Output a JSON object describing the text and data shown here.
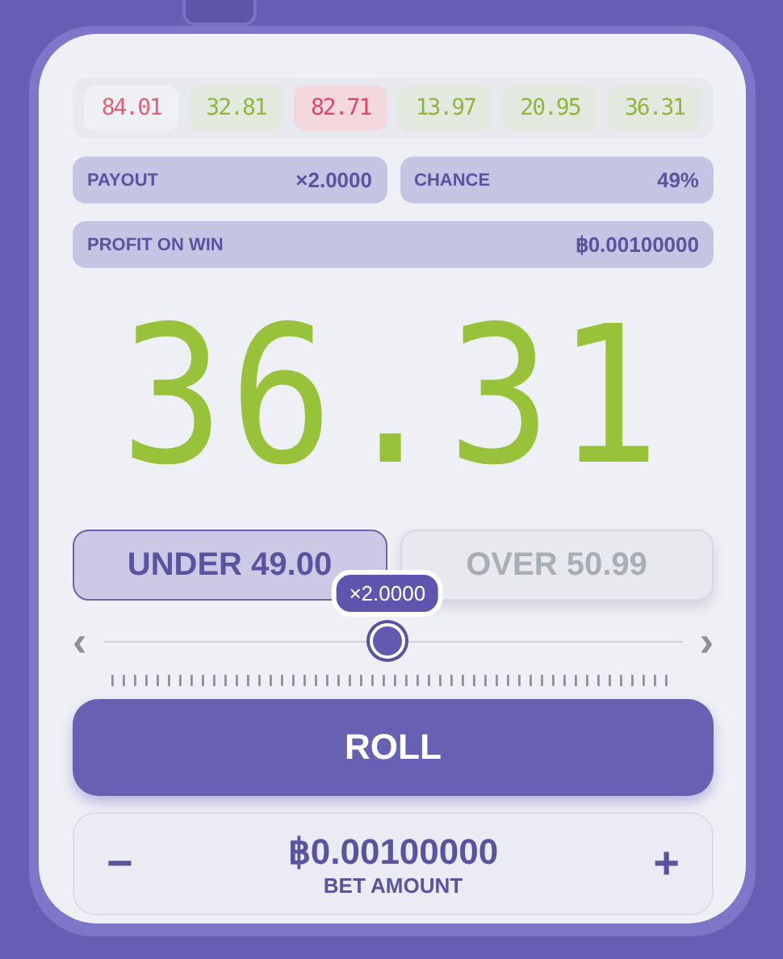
{
  "history": [
    {
      "value": "84.01",
      "color": "#e0607a",
      "faded": true
    },
    {
      "value": "32.81",
      "color": "#8fb83a",
      "faded": false
    },
    {
      "value": "82.71",
      "color": "#e0456a",
      "faded": false
    },
    {
      "value": "13.97",
      "color": "#8fb83a",
      "faded": false
    },
    {
      "value": "20.95",
      "color": "#8fb83a",
      "faded": false
    },
    {
      "value": "36.31",
      "color": "#8fb83a",
      "faded": false
    }
  ],
  "stats": [
    {
      "label": "PAYOUT",
      "value": "×2.0000"
    },
    {
      "label": "CHANCE",
      "value": "49%"
    }
  ],
  "profit": {
    "label": "PROFIT ON WIN",
    "value": "฿0.00100000"
  },
  "result": "36.31",
  "modes": [
    {
      "label": "UNDER 49.00",
      "selected": true
    },
    {
      "label": "OVER 50.99",
      "selected": false
    }
  ],
  "slider": {
    "level": 0.49,
    "tooltip": "×2.0000",
    "prev": "‹",
    "next": "›"
  },
  "roll_button": "ROLL",
  "bet": {
    "amount": "฿0.00100000",
    "label": "BET AMOUNT",
    "minus": "−",
    "plus": "+"
  }
}
